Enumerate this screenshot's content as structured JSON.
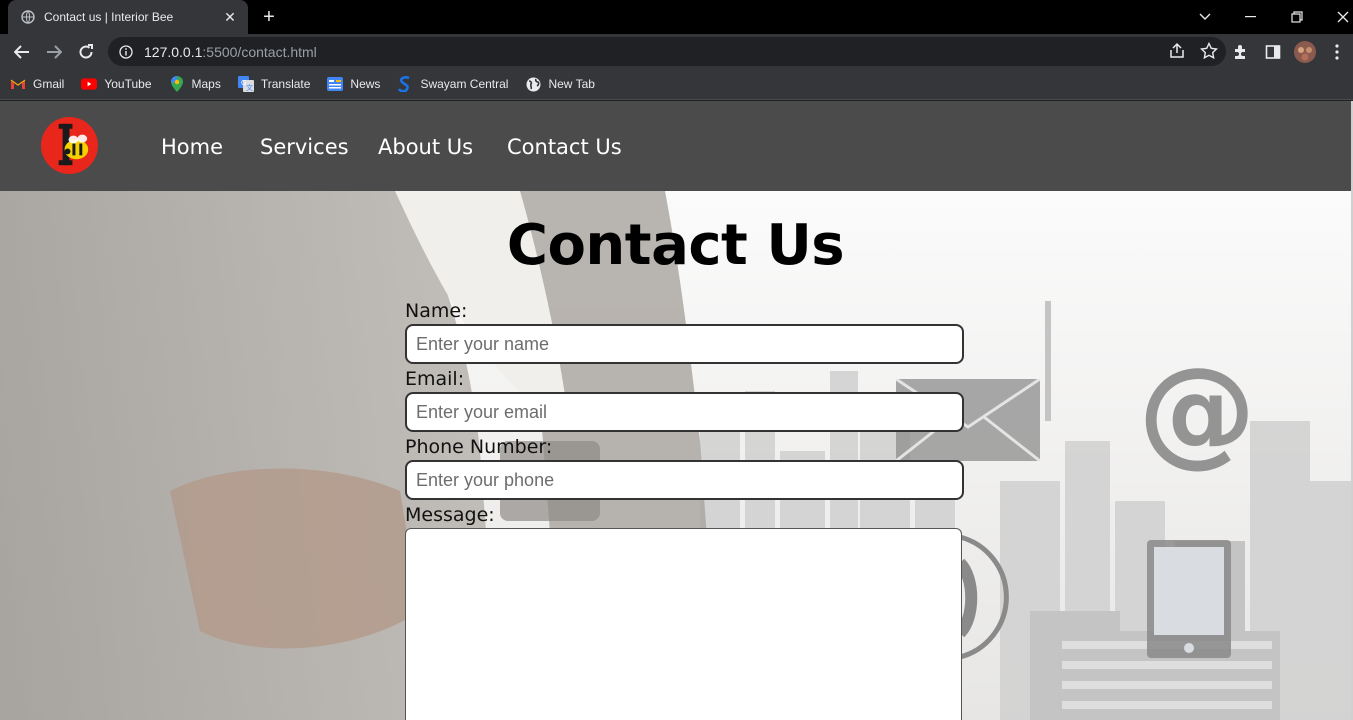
{
  "browser": {
    "tab_title": "Contact us | Interior Bee",
    "url_host": "127.0.0.1",
    "url_path": ":5500/contact.html",
    "bookmarks": [
      {
        "label": "Gmail",
        "icon": "gmail-icon"
      },
      {
        "label": "YouTube",
        "icon": "youtube-icon"
      },
      {
        "label": "Maps",
        "icon": "maps-icon"
      },
      {
        "label": "Translate",
        "icon": "translate-icon"
      },
      {
        "label": "News",
        "icon": "news-icon"
      },
      {
        "label": "Swayam Central",
        "icon": "swayam-icon"
      },
      {
        "label": "New Tab",
        "icon": "globe-icon"
      }
    ]
  },
  "site": {
    "nav": [
      "Home",
      "Services",
      "About Us",
      "Contact Us"
    ],
    "title": "Contact Us",
    "form": {
      "name_label": "Name:",
      "name_placeholder": "Enter your name",
      "email_label": "Email:",
      "email_placeholder": "Enter your email",
      "phone_label": "Phone Number:",
      "phone_placeholder": "Enter your phone",
      "message_label": "Message:"
    }
  },
  "colors": {
    "chrome_dark": "#35363a",
    "site_nav": "#4b4b4b",
    "logo_red": "#e8261c"
  }
}
